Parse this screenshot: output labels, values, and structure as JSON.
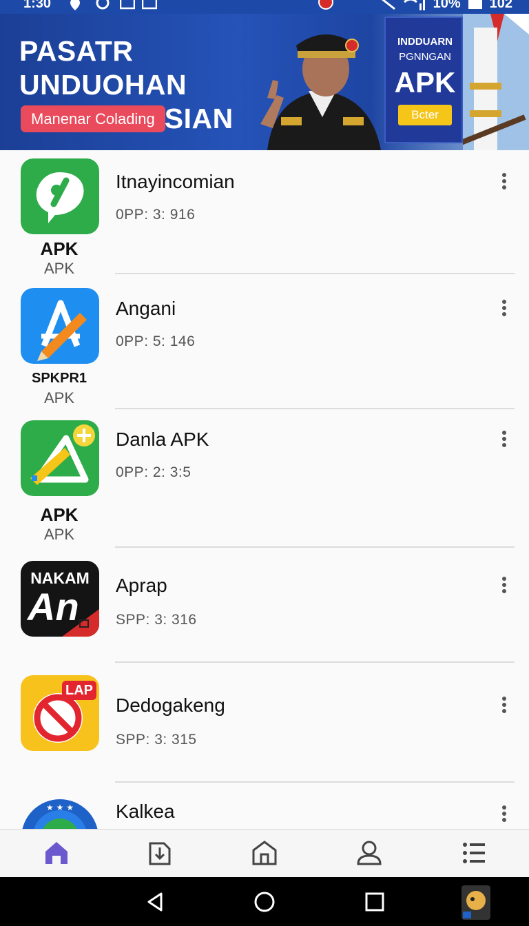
{
  "status_bar": {
    "time": "1:30",
    "battery_text": "10%",
    "right_number": "102"
  },
  "banner": {
    "title": "PASATR UNDUOHAN UNDONEASIAN",
    "cta_label": "Manenar Colading",
    "card": {
      "line1": "INDDUARN",
      "line2": "PGNNGAN",
      "line3": "APK",
      "button_label": "Bcter",
      "button_color": "#f5c518"
    },
    "background_color": "#1d4aa8"
  },
  "apps": [
    {
      "name": "Itnayincomian",
      "meta": "0PP: 3: 916",
      "icon_label_main": "APK",
      "icon_label_sub": "APK",
      "icon": "green-chat-app-icon"
    },
    {
      "name": "Angani",
      "meta": "0PP: 5: 146",
      "icon_label_main": "SPKPR1",
      "icon_label_sub": "APK",
      "icon": "blue-pencil-app-icon"
    },
    {
      "name": "Danla APK",
      "meta": "0PP: 2: 3:5",
      "icon_label_main": "APK",
      "icon_label_sub": "APK",
      "icon": "green-triangle-app-icon"
    },
    {
      "name": "Aprap",
      "meta": "SPP: 3: 316",
      "icon_label_main": "NAKAM",
      "icon_label_sub": "An",
      "icon": "black-an-app-icon"
    },
    {
      "name": "Dedogakeng",
      "meta": "SPP: 3: 315",
      "icon_label_main": "LAP",
      "icon_label_sub": "",
      "icon": "yellow-no-sign-app-icon"
    },
    {
      "name": "Kalkea",
      "meta": "",
      "icon_label_main": "",
      "icon_label_sub": "",
      "icon": "blue-star-circle-app-icon"
    }
  ],
  "bottom_nav": [
    {
      "name": "home",
      "icon": "home-icon",
      "active": true
    },
    {
      "name": "download",
      "icon": "download-icon",
      "active": false
    },
    {
      "name": "store",
      "icon": "store-icon",
      "active": false
    },
    {
      "name": "profile",
      "icon": "profile-icon",
      "active": false
    },
    {
      "name": "menu",
      "icon": "list-icon",
      "active": false
    }
  ],
  "colors": {
    "accent": "#6a5acd",
    "divider": "#dcdcdc",
    "text_primary": "#111111",
    "text_secondary": "#555555"
  }
}
